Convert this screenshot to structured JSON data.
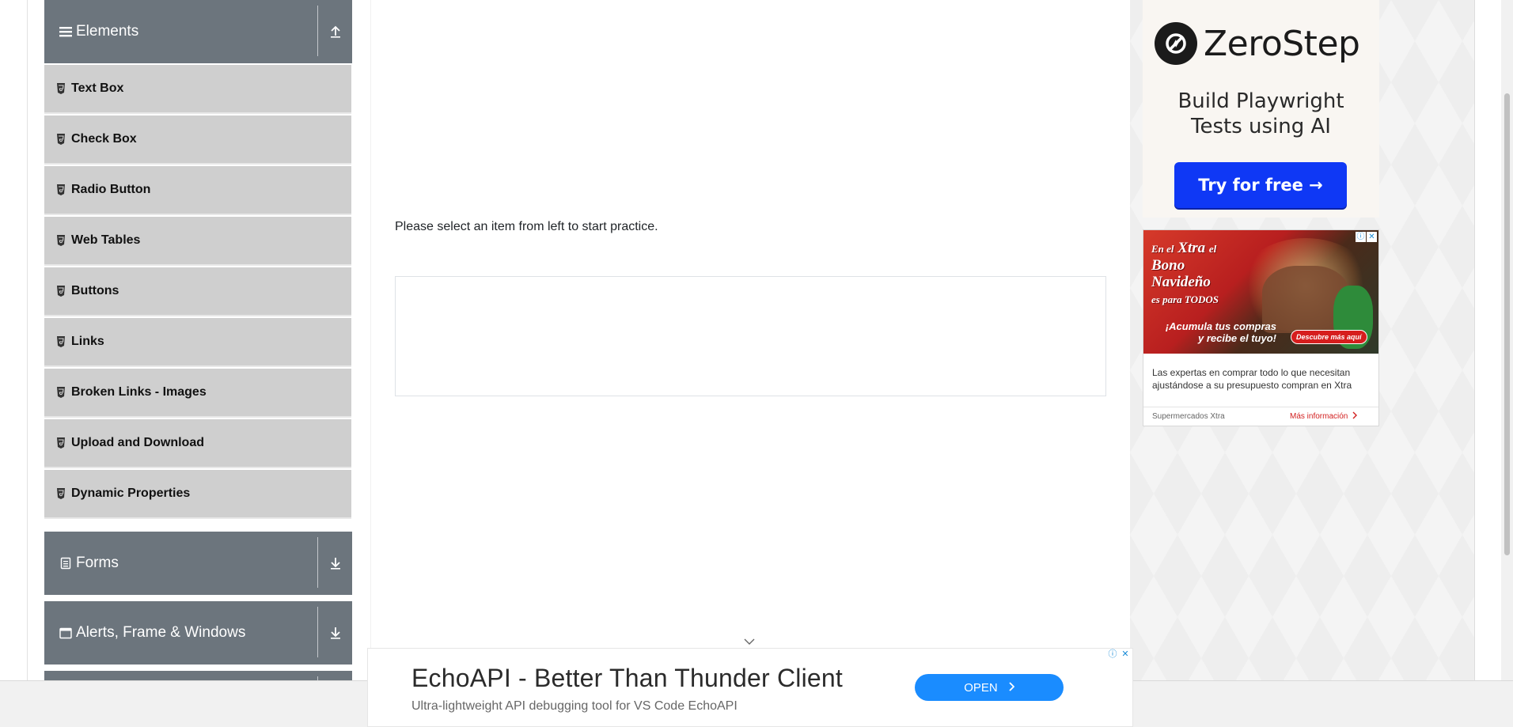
{
  "sidebar": {
    "elements_group": {
      "label": "Elements"
    },
    "items": [
      {
        "label": "Text Box"
      },
      {
        "label": "Check Box"
      },
      {
        "label": "Radio Button"
      },
      {
        "label": "Web Tables"
      },
      {
        "label": "Buttons"
      },
      {
        "label": "Links"
      },
      {
        "label": "Broken Links - Images"
      },
      {
        "label": "Upload and Download"
      },
      {
        "label": "Dynamic Properties"
      }
    ],
    "forms_group": {
      "label": "Forms"
    },
    "alerts_group": {
      "label": "Alerts, Frame & Windows"
    }
  },
  "main": {
    "prompt": "Please select an item from left to start practice."
  },
  "ads": {
    "zerostep": {
      "brand": "ZeroStep",
      "headline_line1": "Build Playwright",
      "headline_line2": "Tests using AI",
      "cta": "Try for free →"
    },
    "xtra": {
      "title_en": "En el",
      "title_brand": "Xtra",
      "title_el": "el",
      "title_bono": "Bono",
      "title_navideno": "Navideño",
      "title_todos": "es para TODOS",
      "sub_line1": "¡Acumula tus compras",
      "sub_line2": "y recibe el tuyo!",
      "badge": "Descubre más aquí",
      "body": "Las expertas en comprar todo lo que necesitan ajustándose a su presupuesto compran en Xtra",
      "advertiser": "Supermercados Xtra",
      "more": "Más información"
    },
    "echo": {
      "title": "EchoAPI - Better Than Thunder Client",
      "subtitle": "Ultra-lightweight API debugging tool for VS Code EchoAPI",
      "cta": "OPEN"
    }
  },
  "colors": {
    "sidebar_header": "#6c757d",
    "menu_item": "#cfcfcf",
    "zerostep_button": "#0f38f5",
    "echo_button": "#1a8cff",
    "xtra_red": "#d21f1f"
  }
}
